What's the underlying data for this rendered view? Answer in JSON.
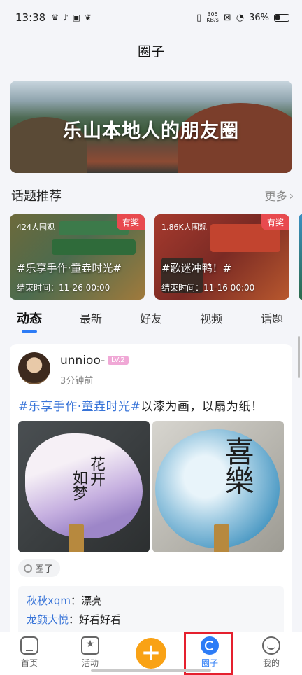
{
  "status_bar": {
    "time": "13:38",
    "net_speed_top": "305",
    "net_speed_unit": "KB/s",
    "battery": "36%"
  },
  "page": {
    "title": "圈子"
  },
  "banner": {
    "title": "乐山本地人的朋友圈"
  },
  "topics_section": {
    "heading": "话题推荐",
    "more": "更多"
  },
  "topics": [
    {
      "views": "424人围观",
      "prize": "有奖",
      "name": "#乐享手作·童垚时光#",
      "end": "结束时间：11-26 00:00"
    },
    {
      "views": "1.86K人围观",
      "prize": "有奖",
      "name": "#歌迷冲鸭！#",
      "end": "结束时间：11-16 00:00"
    }
  ],
  "feed_tabs": [
    "动态",
    "最新",
    "好友",
    "视频",
    "话题"
  ],
  "post": {
    "username": "unnioo-",
    "level": "LV.2",
    "time": "3分钟前",
    "hashtag": "#乐享手作·童垚时光#",
    "text": "以漆为画，以扇为纸！",
    "circle_tag": "圈子",
    "comments": [
      {
        "who": "秋秋xqm",
        "text": "漂亮"
      },
      {
        "who": "龙颜大悦",
        "text": "好看好看"
      }
    ]
  },
  "tab_bar": {
    "items": [
      "首页",
      "活动",
      "圈子",
      "我的"
    ],
    "active": "圈子"
  },
  "colors": {
    "accent": "#2d7cf6",
    "plus": "#f9a215",
    "prize": "#e84a4f"
  }
}
